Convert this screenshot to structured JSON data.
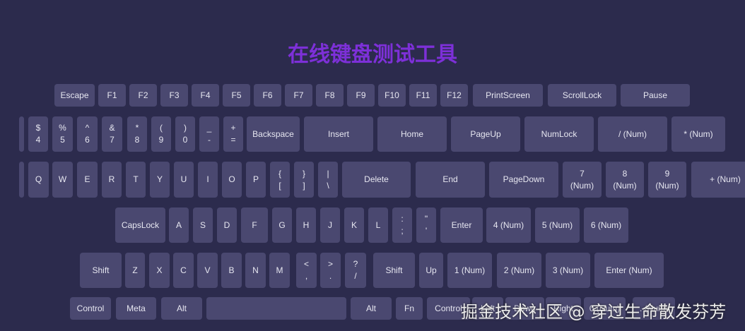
{
  "title": "在线键盘测试工具",
  "watermark": "掘金技术社区 @ 穿过生命散发芬芳",
  "rows": [
    [
      "Escape",
      "F1",
      "F2",
      "F3",
      "F4",
      "F5",
      "F6",
      "F7",
      "F8",
      "F9",
      "F10",
      "F11",
      "F12",
      "PrintScreen",
      "ScrollLock",
      "Pause"
    ],
    [
      "",
      "$\n4",
      "%\n5",
      "^\n6",
      "&\n7",
      "*\n8",
      "(\n9",
      ")\n0",
      "_\n-",
      "+\n=",
      "Backspace",
      "Insert",
      "Home",
      "PageUp",
      "NumLock",
      "/ (Num)",
      "* (Num)"
    ],
    [
      "",
      "Q",
      "W",
      "E",
      "R",
      "T",
      "Y",
      "U",
      "I",
      "O",
      "P",
      "{\n[",
      "}\n]",
      "|\n\\",
      "Delete",
      "End",
      "PageDown",
      "7\n(Num)",
      "8\n(Num)",
      "9\n(Num)",
      "+ (Num)"
    ],
    [
      "CapsLock",
      "A",
      "S",
      "D",
      "F",
      "G",
      "H",
      "J",
      "K",
      "L",
      ":\n;",
      "\"\n'",
      "Enter",
      "4 (Num)",
      "5 (Num)",
      "6 (Num)"
    ],
    [
      "Shift",
      "Z",
      "X",
      "C",
      "V",
      "B",
      "N",
      "M",
      "<\n,",
      ">\n.",
      "?\n/",
      "Shift",
      "Up",
      "1 (Num)",
      "2 (Num)",
      "3 (Num)",
      "Enter (Num)"
    ],
    [
      "Control",
      "Meta",
      "Alt",
      "",
      "Alt",
      "Fn",
      "Control",
      "Left",
      "Down",
      "Right",
      "0 (Num)",
      ". (Num)"
    ]
  ]
}
